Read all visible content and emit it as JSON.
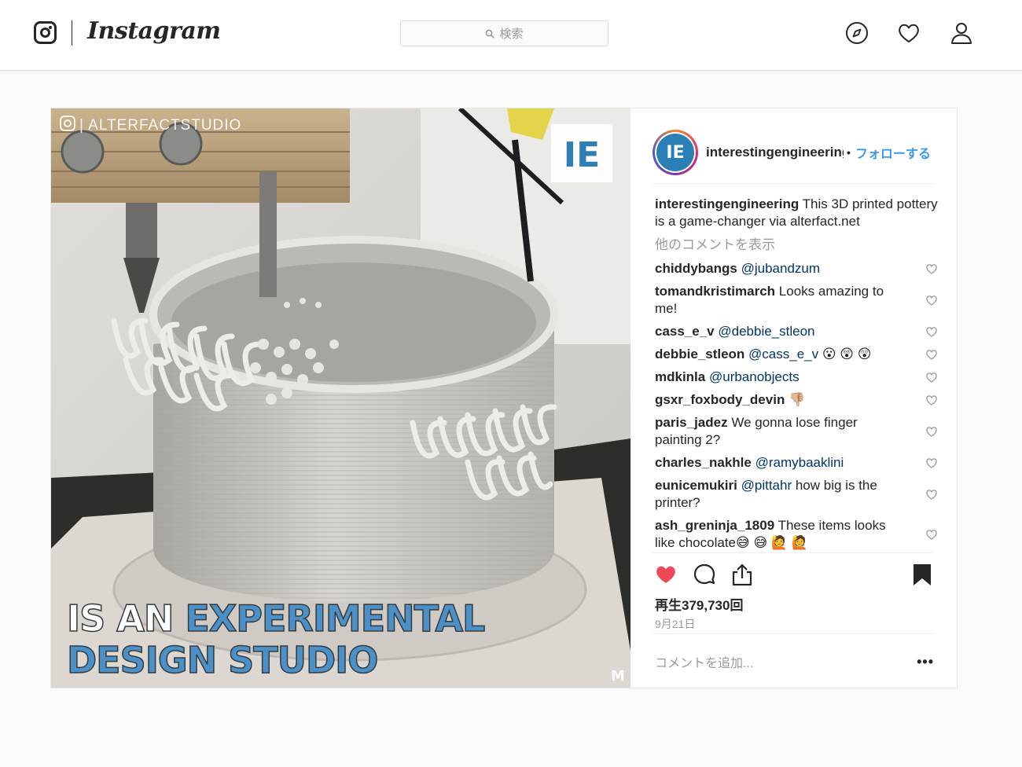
{
  "app": {
    "wordmark": "Instagram"
  },
  "search": {
    "placeholder": "検索"
  },
  "nav": {
    "icons": [
      "compass-icon",
      "heart-icon",
      "person-icon"
    ]
  },
  "post": {
    "header": {
      "username": "interestingengineering",
      "dot": "•",
      "follow_label": "フォローする"
    },
    "media": {
      "watermark": "| ALTERFACTSTUDIO",
      "brand_badge": "IE",
      "overlay_line1_white": "IS AN ",
      "overlay_line1_blue": "EXPERIMENTAL",
      "overlay_line2_blue": "DESIGN STUDIO",
      "corner_mark": "M"
    },
    "caption": {
      "username": "interestingengineering",
      "text": " This 3D printed pottery is a game-changer via alterfact.net"
    },
    "load_more_label": "他のコメントを表示",
    "comments": [
      {
        "user": "chiddybangs",
        "mention": "@jubandzum",
        "text": ""
      },
      {
        "user": "tomandkristimarch",
        "mention": "",
        "text": "Looks amazing to me!"
      },
      {
        "user": "cass_e_v",
        "mention": "@debbie_stleon",
        "text": ""
      },
      {
        "user": "debbie_stleon",
        "mention": "@cass_e_v",
        "text": " 😮 😲 😲"
      },
      {
        "user": "mdkinla",
        "mention": "@urbanobjects",
        "text": ""
      },
      {
        "user": "gsxr_foxbody_devin",
        "mention": "",
        "text": "👎🏼"
      },
      {
        "user": "paris_jadez",
        "mention": "",
        "text": "We gonna lose finger painting 2?"
      },
      {
        "user": "charles_nakhle",
        "mention": "@ramybaaklini",
        "text": ""
      },
      {
        "user": "eunicemukiri",
        "mention": "@pittahr",
        "text": " how big is the printer?"
      },
      {
        "user": "ash_greninja_1809",
        "mention": "",
        "text": "These items looks like chocolate😅 😅 🙋 🙋"
      }
    ],
    "views": "再生379,730回",
    "date": "9月21日",
    "add_comment_placeholder": "コメントを追加...",
    "more_label": "•••",
    "colors": {
      "like_red": "#ed4956",
      "link_blue": "#3897f0",
      "mention_blue": "#003569",
      "overlay_blue": "#4a90c9"
    }
  }
}
